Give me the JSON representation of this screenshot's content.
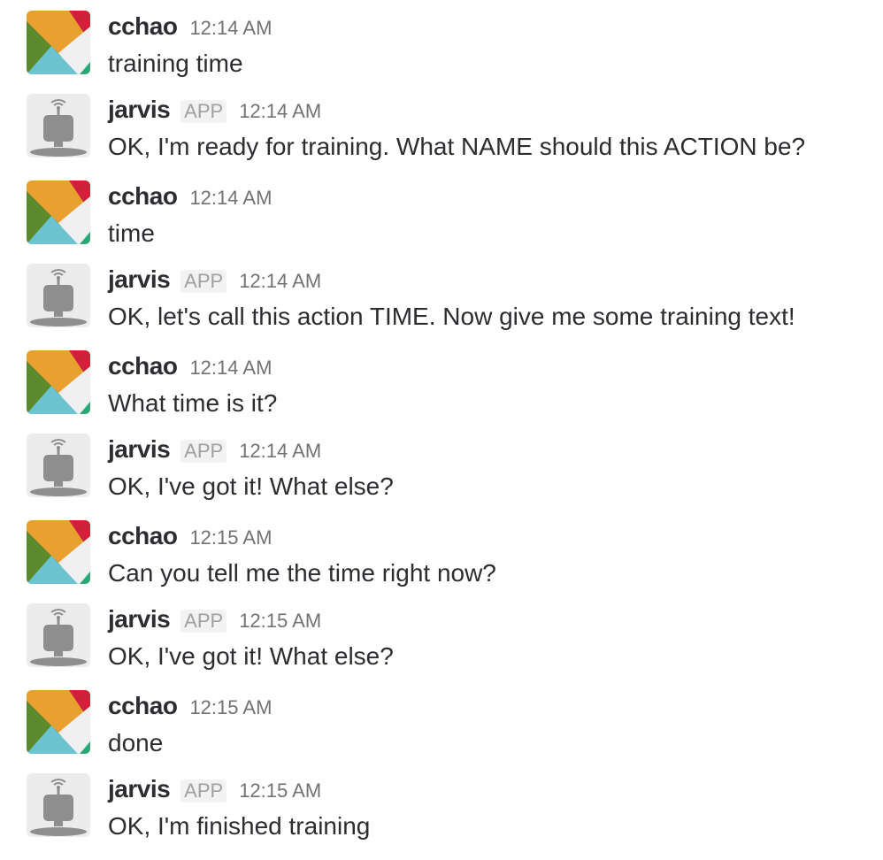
{
  "messages": [
    {
      "user": "cchao",
      "app": false,
      "time": "12:14 AM",
      "text": "training time"
    },
    {
      "user": "jarvis",
      "app": true,
      "badge": "APP",
      "time": "12:14 AM",
      "text": "OK, I'm ready for training. What NAME should this ACTION be?"
    },
    {
      "user": "cchao",
      "app": false,
      "time": "12:14 AM",
      "text": "time"
    },
    {
      "user": "jarvis",
      "app": true,
      "badge": "APP",
      "time": "12:14 AM",
      "text": "OK, let's call this action TIME. Now give me some training text!"
    },
    {
      "user": "cchao",
      "app": false,
      "time": "12:14 AM",
      "text": "What time is it?"
    },
    {
      "user": "jarvis",
      "app": true,
      "badge": "APP",
      "time": "12:14 AM",
      "text": "OK, I've got it! What else?"
    },
    {
      "user": "cchao",
      "app": false,
      "time": "12:15 AM",
      "text": "Can you tell me the time right now?"
    },
    {
      "user": "jarvis",
      "app": true,
      "badge": "APP",
      "time": "12:15 AM",
      "text": "OK, I've got it! What else?"
    },
    {
      "user": "cchao",
      "app": false,
      "time": "12:15 AM",
      "text": "done"
    },
    {
      "user": "jarvis",
      "app": true,
      "badge": "APP",
      "time": "12:15 AM",
      "text": "OK, I'm finished training"
    }
  ],
  "icons": {
    "cchao_avatar": "slack-logo-avatar-icon",
    "jarvis_avatar": "robot-avatar-icon"
  },
  "colors": {
    "text": "#2c2d30",
    "timestamp": "#717274",
    "badge_text": "#a0a0a2",
    "badge_bg": "#f2f2f2",
    "avatar_orange": "#e8a030",
    "avatar_red": "#d0203a",
    "avatar_green": "#5a8a2c",
    "avatar_teal": "#6cc4d0",
    "robot_gray": "#8e8e8e"
  }
}
